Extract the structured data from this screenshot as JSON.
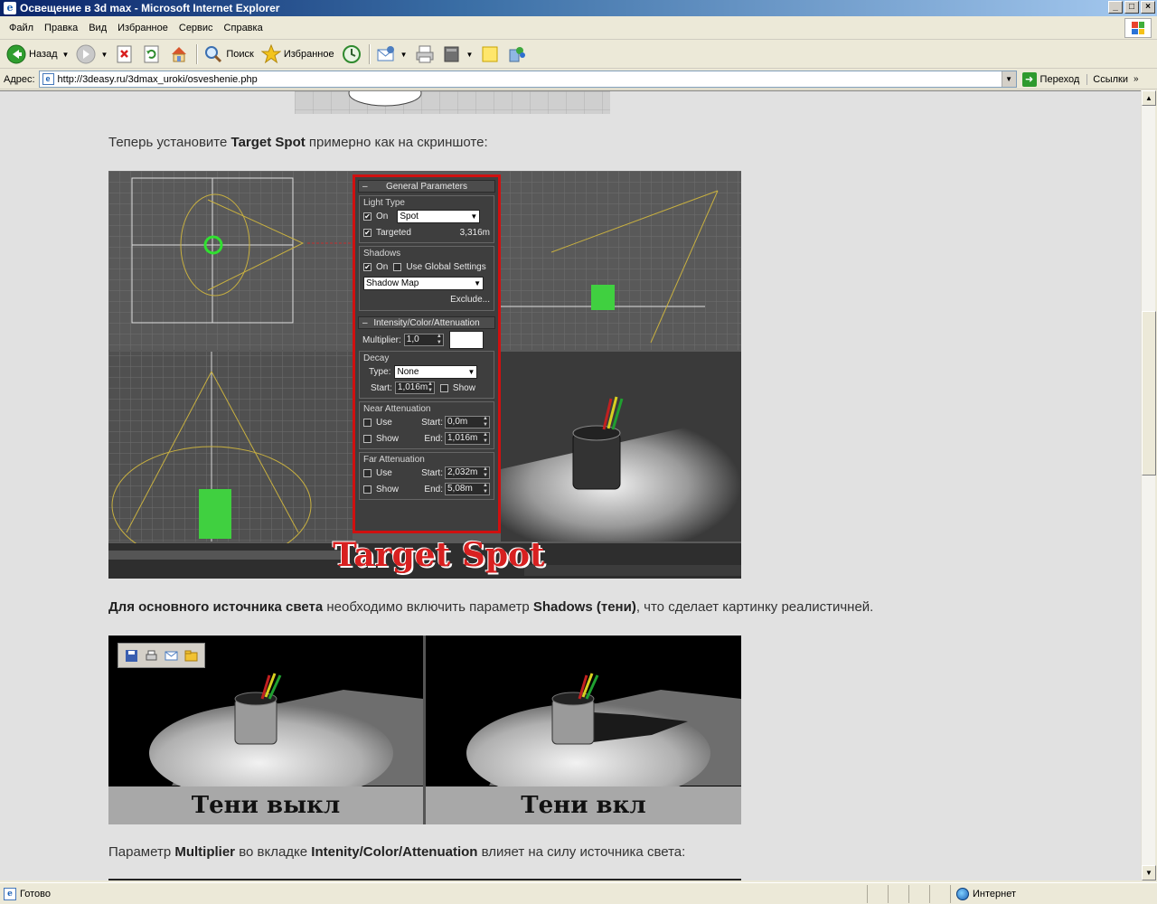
{
  "window": {
    "title": "Освещение в 3d max - Microsoft Internet Explorer",
    "controls": [
      "_",
      "□",
      "×"
    ]
  },
  "menu": {
    "items": [
      "Файл",
      "Правка",
      "Вид",
      "Избранное",
      "Сервис",
      "Справка"
    ]
  },
  "toolbar": {
    "back": "Назад",
    "search": "Поиск",
    "favorites": "Избранное"
  },
  "address": {
    "label": "Адрес:",
    "url": "http://3deasy.ru/3dmax_uroki/osveshenie.php",
    "go": "Переход",
    "links": "Ссылки"
  },
  "article": {
    "p1_pre": "Теперь установите ",
    "p1_bold": "Target Spot",
    "p1_post": " примерно как на скриншоте:",
    "p2_bold1": "Для основного источника света",
    "p2_mid": " необходимо включить параметр ",
    "p2_bold2": "Shadows (тени)",
    "p2_post": ", что сделает картинку реалистичней.",
    "p3_pre": "Параметр ",
    "p3_bold1": "Multiplier",
    "p3_mid": " во вкладке ",
    "p3_bold2": "Intenity/Color/Attenuation",
    "p3_post": " влияет на силу источника света:"
  },
  "panel": {
    "general": "General Parameters",
    "light_type": "Light Type",
    "on": "On",
    "type_value": "Spot",
    "targeted": "Targeted",
    "target_dist": "3,316m",
    "shadows": "Shadows",
    "use_global": "Use Global Settings",
    "shadow_type": "Shadow Map",
    "exclude": "Exclude...",
    "intensity": "Intensity/Color/Attenuation",
    "multiplier_label": "Multiplier:",
    "multiplier_value": "1,0",
    "decay": "Decay",
    "type_label": "Type:",
    "decay_type": "None",
    "start_label": "Start:",
    "decay_start": "1,016m",
    "show": "Show",
    "near_att": "Near Attenuation",
    "use": "Use",
    "near_start": "0,0m",
    "near_end": "1,016m",
    "end_label": "End:",
    "far_att": "Far Attenuation",
    "far_start": "2,032m",
    "far_end": "5,08m",
    "banner": "Target Spot"
  },
  "compare": {
    "left": "Тени выкл",
    "right": "Тени вкл"
  },
  "status": {
    "ready": "Готово",
    "zone": "Интернет"
  }
}
